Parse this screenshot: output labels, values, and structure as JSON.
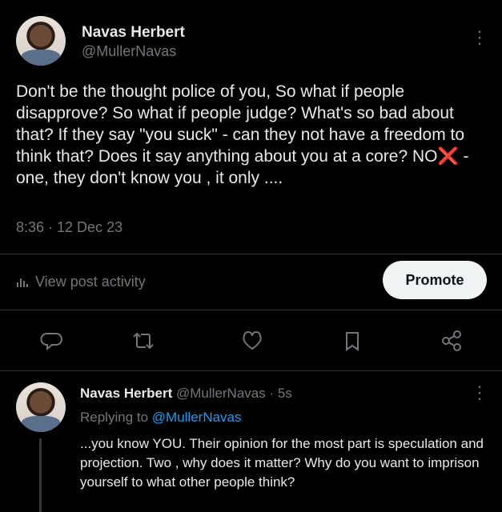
{
  "post": {
    "author_name": "Navas Herbert",
    "author_handle": "@MullerNavas",
    "text_before_mark": "Don't be the thought police of you, So what if people disapprove? So what if people judge? What's so bad about that? If they say \"you suck\" - can they not have a freedom to think that? Does it say anything about you at a core? NO",
    "mark_glyph": "❌",
    "text_after_mark": " - one, they don't know you , it only ....",
    "timestamp": "8:36 · 12 Dec 23",
    "view_activity_label": "View post activity",
    "promote_label": "Promote",
    "more_glyph": "⋮"
  },
  "reply": {
    "author_name": "Navas Herbert",
    "author_handle": "@MullerNavas",
    "time_ago": "· 5s",
    "replying_prefix": "Replying to ",
    "replying_handle": "@MullerNavas",
    "text": "...you know YOU. Their opinion for the most part is speculation and projection. Two , why does it matter? Why do you want to imprison yourself to what other people think?",
    "more_glyph": "⋮"
  },
  "actions": [
    "reply-icon",
    "repost-icon",
    "like-icon",
    "bookmark-icon",
    "share-icon"
  ],
  "colors": {
    "background": "#000000",
    "text": "#e7e9ea",
    "muted": "#71767b",
    "link": "#1d9bf0",
    "promote_bg": "#eff3f4"
  }
}
